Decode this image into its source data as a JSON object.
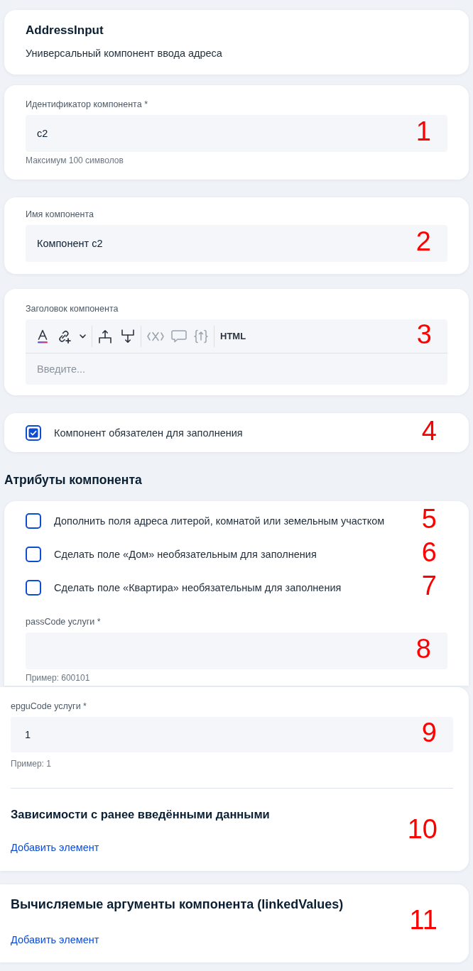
{
  "sections": [
    {
      "kind": "card",
      "items": [
        {
          "kind": "title",
          "text": "AddressInput"
        },
        {
          "kind": "text",
          "text": "Универсальный компонент ввода адреса"
        }
      ]
    },
    {
      "kind": "card",
      "items": [
        {
          "kind": "field",
          "label": "Идентификатор компонента *",
          "value": "c2",
          "hint": "Максимум 100 символов",
          "callout": "1"
        }
      ]
    },
    {
      "kind": "card",
      "items": [
        {
          "kind": "field",
          "label": "Имя компонента",
          "value": "Компонент c2",
          "callout": "2"
        }
      ]
    },
    {
      "kind": "card",
      "items": [
        {
          "kind": "editor",
          "label": "Заголовок компонента",
          "placeholder": "Введите...",
          "toolbar": [
            [
              {
                "kind": "textcolor",
                "disabled": false
              },
              {
                "kind": "link",
                "disabled": false
              },
              {
                "kind": "dropdown",
                "disabled": false
              }
            ],
            [
              {
                "kind": "insertabove",
                "disabled": false
              },
              {
                "kind": "insertbelow",
                "disabled": false
              }
            ],
            [
              {
                "kind": "variable",
                "disabled": true
              },
              {
                "kind": "comment",
                "disabled": true
              },
              {
                "kind": "expression",
                "disabled": true
              }
            ],
            [
              {
                "kind": "html",
                "label": "HTML",
                "disabled": false
              }
            ]
          ],
          "callout": "3"
        }
      ]
    },
    {
      "kind": "card",
      "items": [
        {
          "kind": "checkbox",
          "label": "Компонент обязателен для заполнения",
          "checked": true,
          "callout": "4"
        }
      ]
    },
    {
      "kind": "heading",
      "title": "Атрибуты компонента"
    },
    {
      "kind": "card",
      "items": [
        {
          "kind": "checkbox",
          "label": "Дополнить поля адреса литерой, комнатой или земельным участком",
          "checked": false,
          "callout": "5"
        },
        {
          "kind": "checkbox",
          "label": "Сделать поле «Дом» необязательным для заполнения",
          "checked": false,
          "callout": "6"
        },
        {
          "kind": "checkbox",
          "label": "Сделать поле «Квартира» необязательным для заполнения",
          "checked": false,
          "callout": "7"
        },
        {
          "kind": "field",
          "label": "passCode услуги *",
          "hint": "Пример: 600101",
          "callout": "8"
        }
      ]
    },
    {
      "kind": "card",
      "items": [
        {
          "kind": "field",
          "label": "epguCode услуги *",
          "value": "1",
          "hint": "Пример: 1",
          "callout": "9"
        },
        {
          "kind": "divider"
        },
        {
          "kind": "group",
          "title": "Зависимости с ранее введёнными данными",
          "link": "Добавить элемент",
          "callout": "10"
        }
      ]
    },
    {
      "kind": "card",
      "items": [
        {
          "kind": "group",
          "title": "Вычисляемые аргументы компонента (linkedValues)",
          "link": "Добавить элемент",
          "callout": "11"
        }
      ]
    }
  ]
}
